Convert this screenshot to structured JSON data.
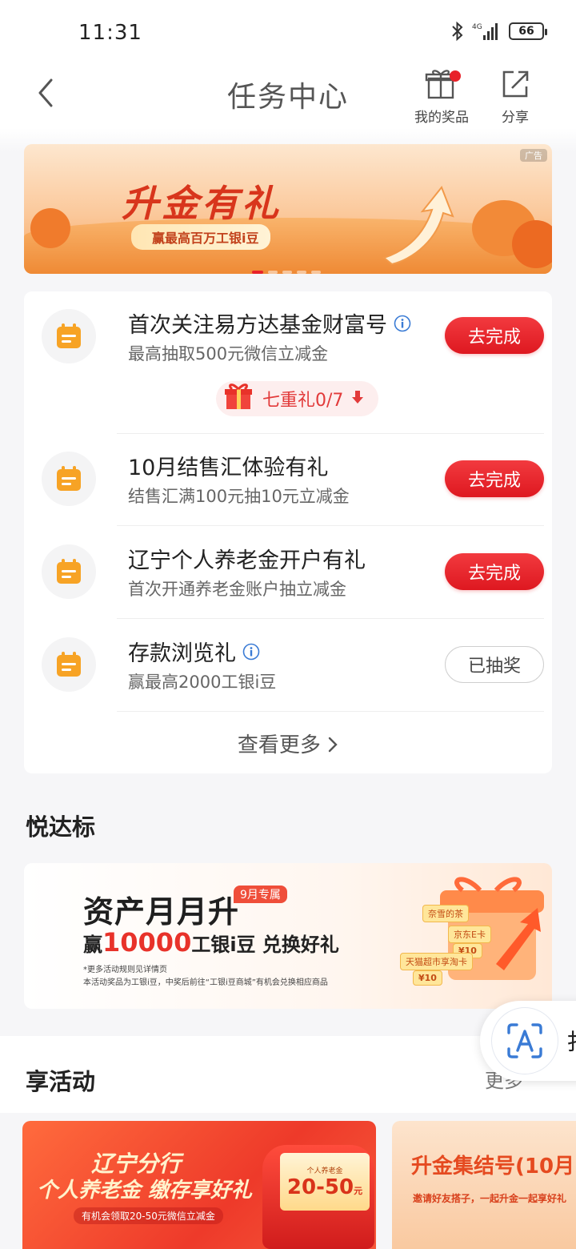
{
  "status_bar": {
    "time": "11:31",
    "network": "4G",
    "battery": "66"
  },
  "nav": {
    "title": "任务中心",
    "prize_label": "我的奖品",
    "share_label": "分享"
  },
  "banner": {
    "title": "升金有礼",
    "subtitle": "赢最高百万工银i豆",
    "ad_label": "广告"
  },
  "tasks": [
    {
      "title": "首次关注易方达基金财富号",
      "subtitle": "最高抽取500元微信立减金",
      "button": "去完成",
      "has_info": true,
      "status": "todo"
    },
    {
      "title": "10月结售汇体验有礼",
      "subtitle": "结售汇满100元抽10元立减金",
      "button": "去完成",
      "has_info": false,
      "status": "todo"
    },
    {
      "title": "辽宁个人养老金开户有礼",
      "subtitle": "首次开通养老金账户抽立减金",
      "button": "去完成",
      "has_info": false,
      "status": "todo"
    },
    {
      "title": "存款浏览礼",
      "subtitle": "赢最高2000工银i豆",
      "button": "已抽奖",
      "has_info": true,
      "status": "done"
    }
  ],
  "gift_pill": {
    "label": "七重礼0/7"
  },
  "more_link": "查看更多",
  "section_yuedabiao": {
    "title": "悦达标"
  },
  "promo": {
    "title": "资产月月升",
    "tag": "9月专属",
    "sub_prefix": "赢",
    "sub_number": "10000",
    "sub_suffix": "工银i豆 兑换好礼",
    "note1": "*更多活动规则见详情页",
    "note2": "本活动奖品为工银i豆，中奖后前往“工银i豆商城”有机会兑换相应商品",
    "chips": [
      "奈雪的茶",
      "京东E卡",
      "天猫超市享淘卡",
      "¥10",
      "¥10"
    ]
  },
  "section_activity": {
    "title": "享活动",
    "more": "更多"
  },
  "float_button": {
    "label": "扌"
  },
  "activities": [
    {
      "title1": "辽宁分行",
      "title2": "个人养老金 缴存享好礼",
      "note": "有机会领取20-50元微信立减金",
      "ticket_top": "个人养老金",
      "ticket_amount": "20-50",
      "ticket_unit": "元"
    },
    {
      "title": "升金集结号(10月",
      "subtitle": "邀请好友搭子，一起升金一起享好礼"
    }
  ],
  "colors": {
    "accent_red": "#E8222A",
    "task_icon": "#F7A325",
    "promo_red": "#E8322A"
  }
}
